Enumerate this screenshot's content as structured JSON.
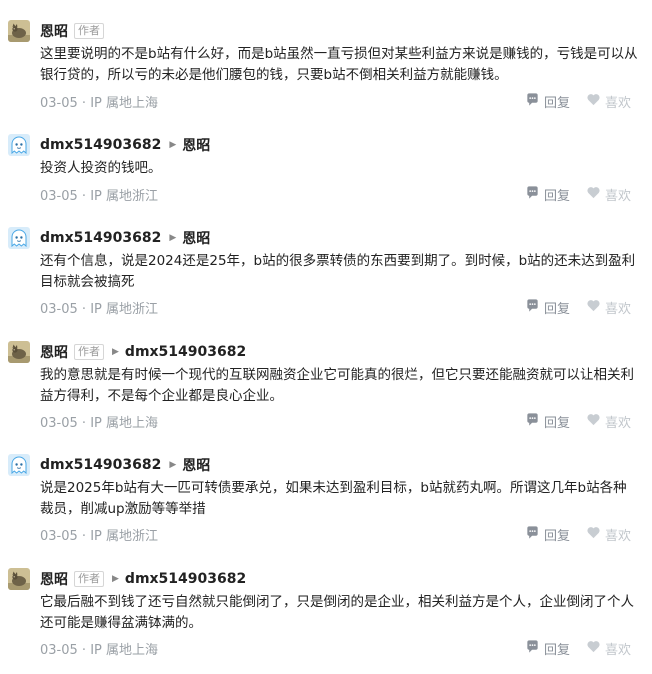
{
  "colors": {
    "text": "#222222",
    "meta": "#9aa0a6",
    "reply_icon": "#8a9099",
    "like_icon": "#c2c7cc"
  },
  "comments": [
    {
      "author": "恩昭",
      "avatar": "cat-avatar",
      "badge": "作者",
      "reply_to": "",
      "text": "这里要说明的不是b站有什么好，而是b站虽然一直亏损但对某些利益方来说是赚钱的，亏钱是可以从银行贷的，所以亏的未必是他们腰包的钱，只要b站不倒相关利益方就能赚钱。",
      "date": "03-05",
      "location": "IP 属地上海",
      "reply_label": "回复",
      "like_label": "喜欢"
    },
    {
      "author": "dmx514903682",
      "avatar": "ghost-avatar",
      "badge": "",
      "reply_to": "恩昭",
      "text": "投资人投资的钱吧。",
      "date": "03-05",
      "location": "IP 属地浙江",
      "reply_label": "回复",
      "like_label": "喜欢"
    },
    {
      "author": "dmx514903682",
      "avatar": "ghost-avatar",
      "badge": "",
      "reply_to": "恩昭",
      "text": "还有个信息，说是2024还是25年，b站的很多票转债的东西要到期了。到时候，b站的还未达到盈利目标就会被搞死",
      "date": "03-05",
      "location": "IP 属地浙江",
      "reply_label": "回复",
      "like_label": "喜欢"
    },
    {
      "author": "恩昭",
      "avatar": "cat-avatar",
      "badge": "作者",
      "reply_to": "dmx514903682",
      "text": "我的意思就是有时候一个现代的互联网融资企业它可能真的很烂，但它只要还能融资就可以让相关利益方得利，不是每个企业都是良心企业。",
      "date": "03-05",
      "location": "IP 属地上海",
      "reply_label": "回复",
      "like_label": "喜欢"
    },
    {
      "author": "dmx514903682",
      "avatar": "ghost-avatar",
      "badge": "",
      "reply_to": "恩昭",
      "text": "说是2025年b站有大一匹可转债要承兑，如果未达到盈利目标，b站就药丸啊。所谓这几年b站各种裁员，削减up激励等等举措",
      "date": "03-05",
      "location": "IP 属地浙江",
      "reply_label": "回复",
      "like_label": "喜欢"
    },
    {
      "author": "恩昭",
      "avatar": "cat-avatar",
      "badge": "作者",
      "reply_to": "dmx514903682",
      "text": "它最后融不到钱了还亏自然就只能倒闭了，只是倒闭的是企业，相关利益方是个人，企业倒闭了个人还可能是赚得盆满钵满的。",
      "date": "03-05",
      "location": "IP 属地上海",
      "reply_label": "回复",
      "like_label": "喜欢"
    }
  ]
}
